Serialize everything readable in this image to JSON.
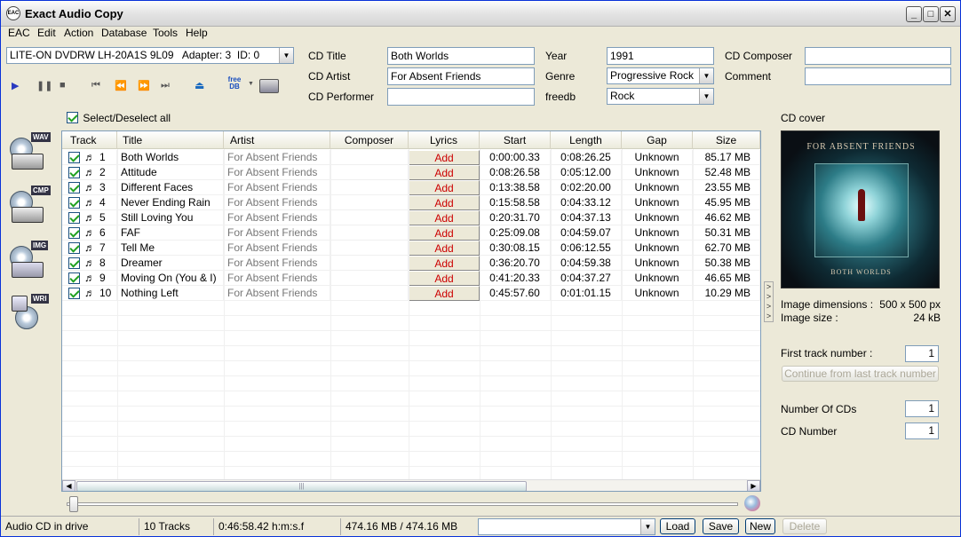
{
  "window": {
    "title": "Exact Audio Copy",
    "app_icon_text": "EAC"
  },
  "menu": [
    "EAC",
    "Edit",
    "Action",
    "Database",
    "Tools",
    "Help"
  ],
  "drive": {
    "selected": "LITE-ON DVDRW LH-20A1S 9L09   Adapter: 3  ID: 0"
  },
  "cd_info": {
    "title_label": "CD Title",
    "title": "Both Worlds",
    "artist_label": "CD Artist",
    "artist": "For Absent Friends",
    "performer_label": "CD Performer",
    "performer": "",
    "year_label": "Year",
    "year": "1991",
    "genre_label": "Genre",
    "genre": "Progressive Rock",
    "freedb_label": "freedb",
    "freedb": "Rock",
    "composer_label": "CD Composer",
    "composer": "",
    "comment_label": "Comment",
    "comment": ""
  },
  "toolbar": {
    "freedb_icon_text": "free DB"
  },
  "select_all_label": "Select/Deselect all",
  "side_tags": [
    "WAV",
    "CMP",
    "IMG",
    "WRI"
  ],
  "columns": [
    "Track",
    "Title",
    "Artist",
    "Composer",
    "Lyrics",
    "Start",
    "Length",
    "Gap",
    "Size"
  ],
  "tracks": [
    {
      "num": "1",
      "title": "Both Worlds",
      "artist": "For Absent Friends",
      "composer": "",
      "lyrics": "Add",
      "start": "0:00:00.33",
      "length": "0:08:26.25",
      "gap": "Unknown",
      "size": "85.17 MB"
    },
    {
      "num": "2",
      "title": "Attitude",
      "artist": "For Absent Friends",
      "composer": "",
      "lyrics": "Add",
      "start": "0:08:26.58",
      "length": "0:05:12.00",
      "gap": "Unknown",
      "size": "52.48 MB"
    },
    {
      "num": "3",
      "title": "Different Faces",
      "artist": "For Absent Friends",
      "composer": "",
      "lyrics": "Add",
      "start": "0:13:38.58",
      "length": "0:02:20.00",
      "gap": "Unknown",
      "size": "23.55 MB"
    },
    {
      "num": "4",
      "title": "Never Ending Rain",
      "artist": "For Absent Friends",
      "composer": "",
      "lyrics": "Add",
      "start": "0:15:58.58",
      "length": "0:04:33.12",
      "gap": "Unknown",
      "size": "45.95 MB"
    },
    {
      "num": "5",
      "title": "Still Loving You",
      "artist": "For Absent Friends",
      "composer": "",
      "lyrics": "Add",
      "start": "0:20:31.70",
      "length": "0:04:37.13",
      "gap": "Unknown",
      "size": "46.62 MB"
    },
    {
      "num": "6",
      "title": "FAF",
      "artist": "For Absent Friends",
      "composer": "",
      "lyrics": "Add",
      "start": "0:25:09.08",
      "length": "0:04:59.07",
      "gap": "Unknown",
      "size": "50.31 MB"
    },
    {
      "num": "7",
      "title": "Tell Me",
      "artist": "For Absent Friends",
      "composer": "",
      "lyrics": "Add",
      "start": "0:30:08.15",
      "length": "0:06:12.55",
      "gap": "Unknown",
      "size": "62.70 MB"
    },
    {
      "num": "8",
      "title": "Dreamer",
      "artist": "For Absent Friends",
      "composer": "",
      "lyrics": "Add",
      "start": "0:36:20.70",
      "length": "0:04:59.38",
      "gap": "Unknown",
      "size": "50.38 MB"
    },
    {
      "num": "9",
      "title": "Moving On (You & I)",
      "artist": "For Absent Friends",
      "composer": "",
      "lyrics": "Add",
      "start": "0:41:20.33",
      "length": "0:04:37.27",
      "gap": "Unknown",
      "size": "46.65 MB"
    },
    {
      "num": "10",
      "title": "Nothing Left",
      "artist": "For Absent Friends",
      "composer": "",
      "lyrics": "Add",
      "start": "0:45:57.60",
      "length": "0:01:01.15",
      "gap": "Unknown",
      "size": "10.29 MB"
    }
  ],
  "cover": {
    "label": "CD cover",
    "art_top_text": "FOR ABSENT FRIENDS",
    "art_bottom_text": "BOTH WORLDS",
    "dimensions_label": "Image dimensions :",
    "dimensions": "500 x 500 px",
    "size_label": "Image size :",
    "size": "24 kB"
  },
  "numbering": {
    "first_track_label": "First track number :",
    "first_track": "1",
    "continue_button": "Continue from last track number",
    "num_cds_label": "Number Of CDs",
    "num_cds": "1",
    "cd_number_label": "CD Number",
    "cd_number": "1"
  },
  "status": {
    "drive_state": "Audio CD in drive",
    "tracks": "10 Tracks",
    "total_time": "0:46:58.42 h:m:s.f",
    "total_size": "474.16 MB / 474.16 MB",
    "profile": ""
  },
  "buttons": {
    "load": "Load",
    "save": "Save",
    "new": "New",
    "delete": "Delete"
  }
}
